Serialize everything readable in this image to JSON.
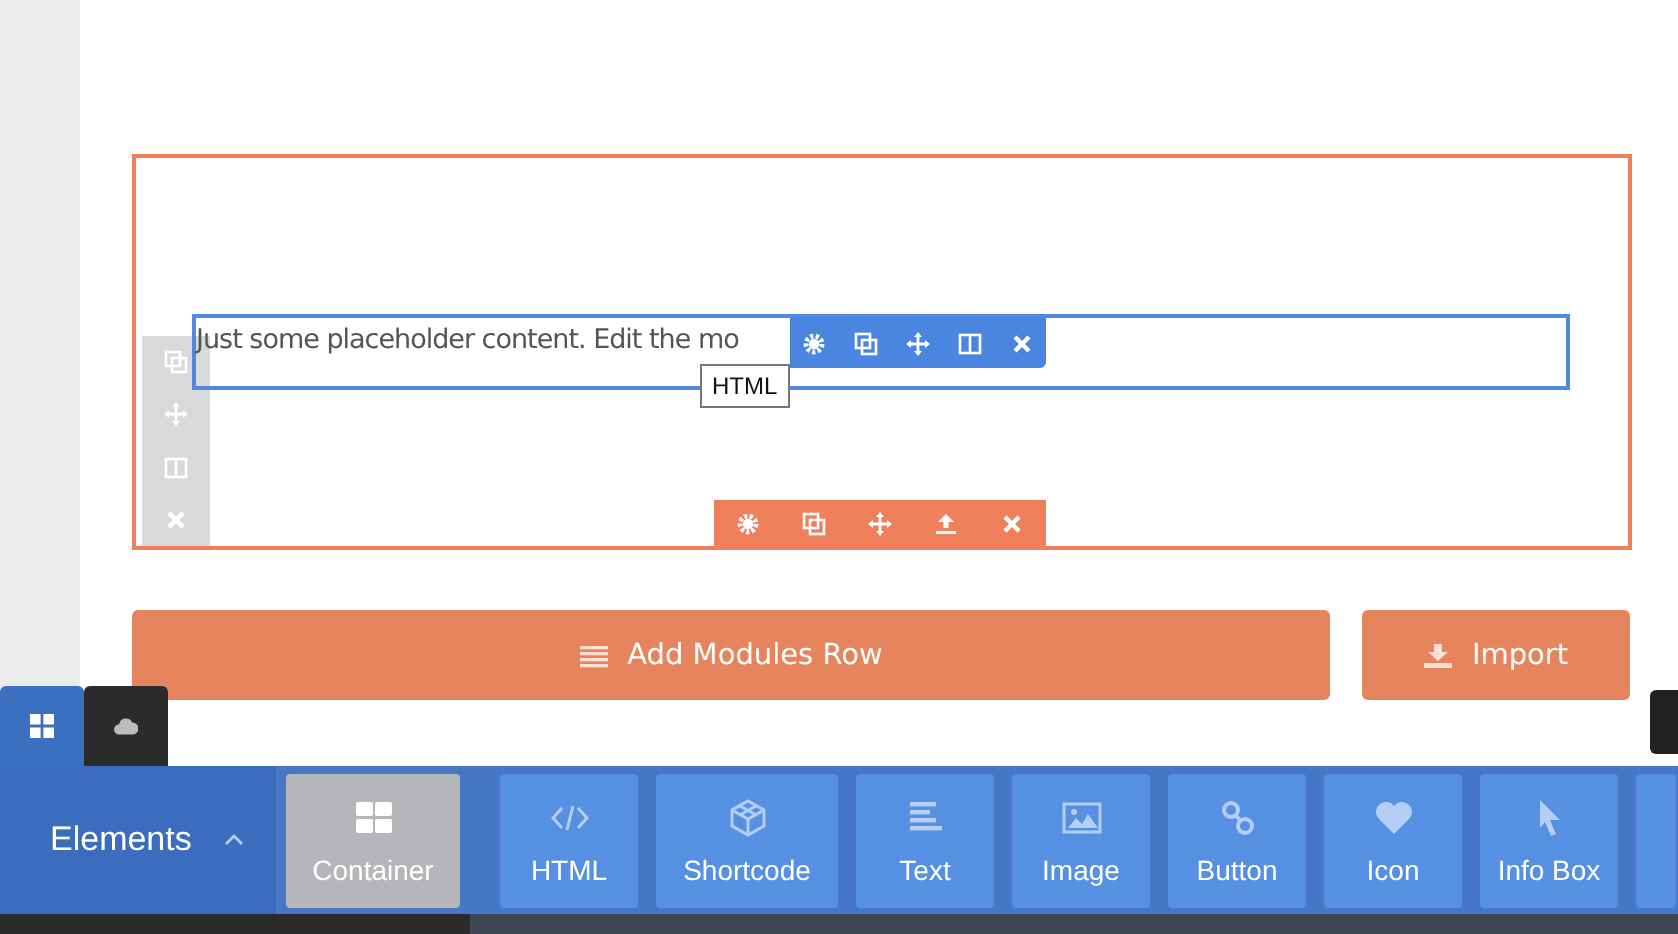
{
  "module": {
    "text": "Just some placeholder content. Edit the mo",
    "tooltip": "HTML"
  },
  "row_actions": {
    "add_row": "Add Modules Row",
    "import": "Import"
  },
  "tabs": [
    {
      "kind": "grid",
      "selected": true
    },
    {
      "kind": "cloud",
      "selected": false
    }
  ],
  "panel": {
    "title": "Elements",
    "expanded": true
  },
  "elements": [
    {
      "kind": "container",
      "label": "Container",
      "selected": true
    },
    {
      "kind": "code",
      "label": "HTML",
      "selected": false
    },
    {
      "kind": "shortcode",
      "label": "Shortcode",
      "selected": false
    },
    {
      "kind": "text",
      "label": "Text",
      "selected": false
    },
    {
      "kind": "image",
      "label": "Image",
      "selected": false
    },
    {
      "kind": "link",
      "label": "Button",
      "selected": false
    },
    {
      "kind": "heart",
      "label": "Icon",
      "selected": false
    },
    {
      "kind": "pointer",
      "label": "Info Box",
      "selected": false
    }
  ]
}
